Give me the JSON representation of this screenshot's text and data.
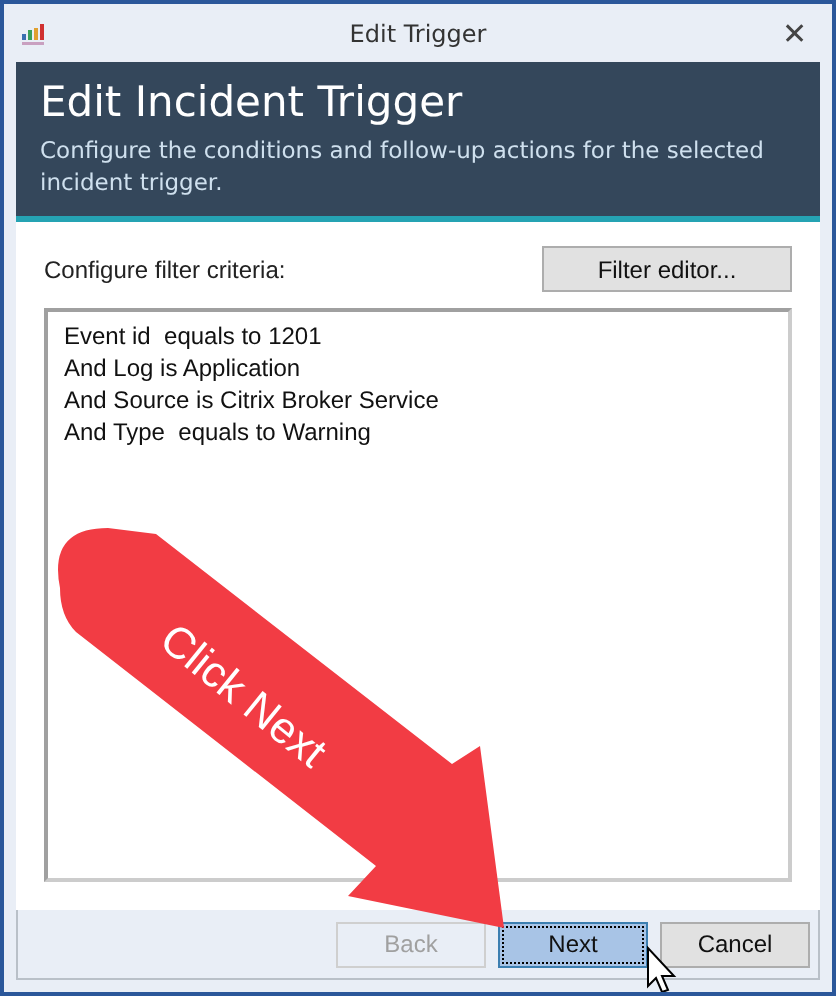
{
  "window": {
    "title": "Edit Trigger",
    "close": "✕"
  },
  "header": {
    "title": "Edit Incident Trigger",
    "subtitle": "Configure the conditions and follow-up actions for the selected incident trigger."
  },
  "filter": {
    "label": "Configure filter criteria:",
    "button": "Filter editor...",
    "criteria": [
      "Event id  equals to 1201",
      "And Log is Application",
      "And Source is Citrix Broker Service",
      "And Type  equals to Warning"
    ]
  },
  "buttons": [
    {
      "label": "Back",
      "disabled": true,
      "focused": false
    },
    {
      "label": "Next",
      "disabled": false,
      "focused": true
    },
    {
      "label": "Cancel",
      "disabled": false,
      "focused": false
    }
  ],
  "annotation": {
    "text": "Click Next"
  }
}
